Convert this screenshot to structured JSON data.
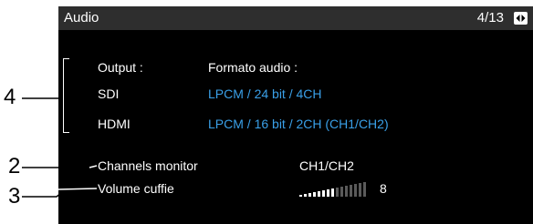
{
  "header": {
    "title": "Audio",
    "page_indicator": "4/13",
    "nav_icon": "page-nav-icon"
  },
  "output": {
    "label": "Output :",
    "column_header": "Formato audio :",
    "rows": [
      {
        "label": "SDI",
        "value": "LPCM / 24 bit / 4CH"
      },
      {
        "label": "HDMI",
        "value": "LPCM / 16 bit / 2CH (CH1/CH2)"
      }
    ]
  },
  "channels_monitor": {
    "label": "Channels monitor",
    "value": "CH1/CH2"
  },
  "headphone_volume": {
    "label": "Volume cuffie",
    "level": 8,
    "max": 15,
    "value": "8"
  },
  "callouts": {
    "output": "4",
    "channels": "2",
    "volume": "3"
  },
  "colors": {
    "value_text": "#3aa0e8",
    "screen_bg": "#000000",
    "titlebar_bg": "#2e2e2e"
  }
}
